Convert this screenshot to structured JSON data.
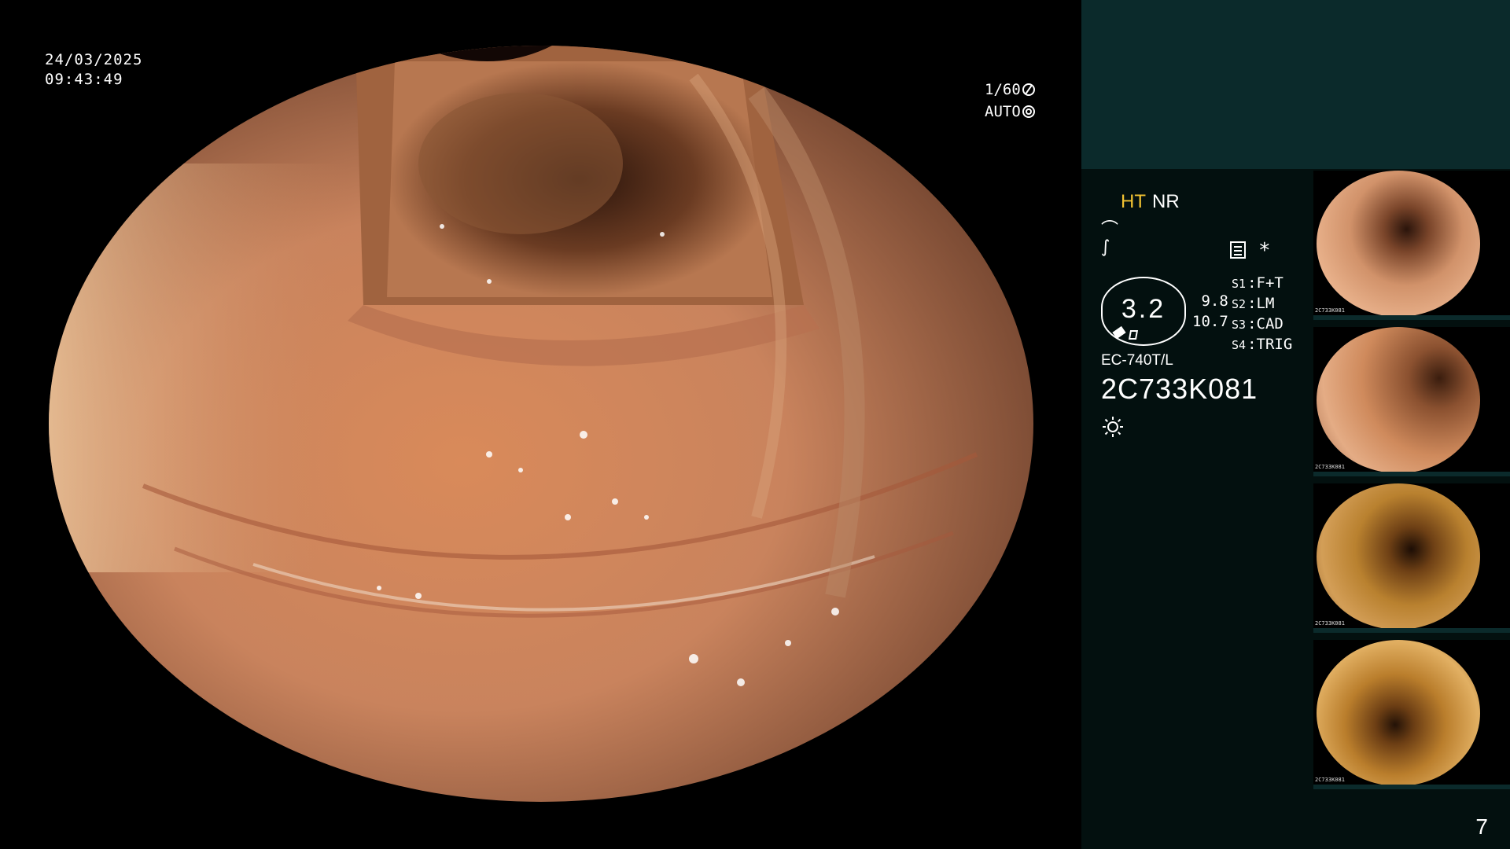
{
  "overlay": {
    "date": "24/03/2025",
    "time": "09:43:49",
    "shutter": "1/60",
    "exposure_mode": "AUTO"
  },
  "panel": {
    "mode_ht": "HT",
    "mode_nr": "NR",
    "gauge_value": "3.2",
    "reading_1": "9.8",
    "reading_2": "10.7",
    "switches": [
      {
        "key": "S1",
        "value": "F+T"
      },
      {
        "key": "S2",
        "value": "LM"
      },
      {
        "key": "S3",
        "value": "CAD"
      },
      {
        "key": "S4",
        "value": "TRIG"
      }
    ],
    "model": "EC-740T/L",
    "serial": "2C733K081",
    "star": "*",
    "page_number": "7"
  },
  "thumbnails": [
    {
      "label": "2C733K081"
    },
    {
      "label": "2C733K081"
    },
    {
      "label": "2C733K081"
    },
    {
      "label": "2C733K081"
    }
  ],
  "colors": {
    "panel_top": "#0b2a2b",
    "panel_bg": "#03100f",
    "mode_accent": "#f1c232",
    "tissue": "#c8845a"
  }
}
